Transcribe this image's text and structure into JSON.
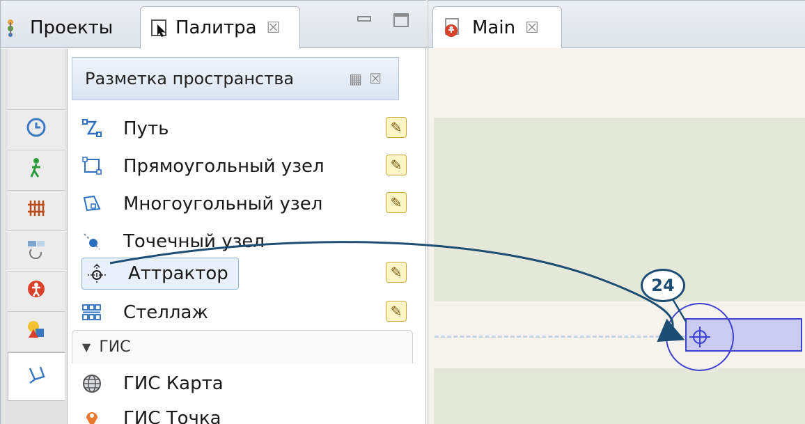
{
  "left_tabs": {
    "projects_label": "Проекты",
    "palette_label": "Палитра",
    "close_glyph": "☒"
  },
  "palette": {
    "section_title": "Разметка пространства",
    "items": [
      {
        "label": "Путь",
        "icon": "path-icon",
        "editable": true
      },
      {
        "label": "Прямоугольный узел",
        "icon": "rect-node-icon",
        "editable": true
      },
      {
        "label": "Многоугольный узел",
        "icon": "polygon-node-icon",
        "editable": true
      },
      {
        "label": "Точечный узел",
        "icon": "point-node-icon",
        "editable": false
      },
      {
        "label": "Аттрактор",
        "icon": "attractor-icon",
        "editable": true,
        "selected": true
      },
      {
        "label": "Стеллаж",
        "icon": "rack-icon",
        "editable": true
      }
    ],
    "gis_header": "ГИС",
    "gis_items": [
      {
        "label": "ГИС Карта",
        "icon": "globe-icon"
      },
      {
        "label": "ГИС Точка",
        "icon": "map-pin-icon"
      }
    ]
  },
  "categories": [
    "blank",
    "time-icon",
    "pedestrian-icon",
    "rail-icon",
    "process-icon",
    "accessibility-icon",
    "shapes-icon",
    "space-markup-icon"
  ],
  "editor": {
    "tab_label": "Main",
    "callout_number": "24"
  },
  "colors": {
    "accent_blue": "#2c6fbf",
    "callout_dark": "#1e4d73",
    "node_stroke": "#3d3fcf",
    "node_fill": "#c9cbf0",
    "band_green": "#e3e8d8"
  }
}
